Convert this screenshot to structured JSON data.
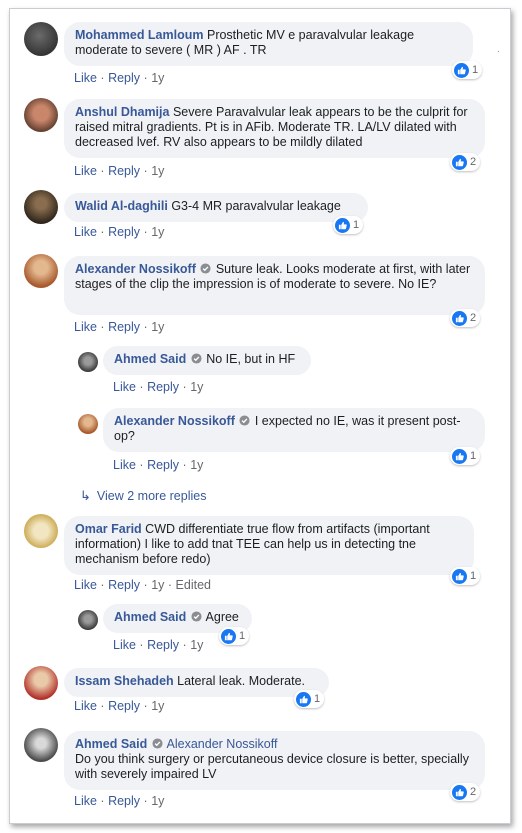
{
  "comments": [
    {
      "name": "Mohammed Lamloum",
      "text": "Prosthetic MV e paravalvular leakage moderate to severe ( MR ) AF . TR",
      "like": "Like",
      "reply": "Reply",
      "time": "1y",
      "reactions": "1"
    },
    {
      "name": "Anshul Dhamija",
      "text": "Severe Paravalvular leak appears to be the culprit for raised mitral gradients. Pt is in AFib. Moderate TR. LA/LV dilated with decreased lvef. RV also appears to be mildly dilated",
      "like": "Like",
      "reply": "Reply",
      "time": "1y",
      "reactions": "2"
    },
    {
      "name": "Walid Al-daghili",
      "text": "G3-4 MR paravalvular leakage",
      "like": "Like",
      "reply": "Reply",
      "time": "1y",
      "reactions": "1"
    },
    {
      "name": "Alexander Nossikoff",
      "text": "Suture leak. Looks moderate at first, with later stages of the clip the impression is of moderate to severe. No IE?",
      "like": "Like",
      "reply": "Reply",
      "time": "1y",
      "reactions": "2"
    },
    {
      "name": "Ahmed Said",
      "text": "No IE, but in HF",
      "like": "Like",
      "reply": "Reply",
      "time": "1y"
    },
    {
      "name": "Alexander Nossikoff",
      "text": "I expected no IE, was it present post-op?",
      "like": "Like",
      "reply": "Reply",
      "time": "1y",
      "reactions": "1"
    },
    {
      "name": "Omar Farid",
      "text": "CWD differentiate true flow from artifacts (important information) I like to add tnat TEE can help us in detecting tne mechanism before redo)",
      "like": "Like",
      "reply": "Reply",
      "time": "1y",
      "edited": "Edited",
      "reactions": "1"
    },
    {
      "name": "Ahmed Said",
      "text": "Agree",
      "like": "Like",
      "reply": "Reply",
      "time": "1y",
      "reactions": "1"
    },
    {
      "name": "Issam Shehadeh",
      "text": "Lateral leak. Moderate.",
      "like": "Like",
      "reply": "Reply",
      "time": "1y",
      "reactions": "1"
    },
    {
      "name": "Ahmed Said",
      "mention": "Alexander Nossikoff",
      "text": "Do you think surgery or percutaneous device closure is better, specially with severely impaired LV",
      "like": "Like",
      "reply": "Reply",
      "time": "1y",
      "reactions": "2"
    }
  ],
  "view_more_replies": "View 2 more replies",
  "separator": "·",
  "dot": ".",
  "colors": {
    "link": "#385898",
    "bubble": "#f0f2f5",
    "like_blue": "#1877f2",
    "meta": "#65676b"
  },
  "icons": [
    "like-thumb-icon",
    "verified-badge-icon",
    "reply-arrow-icon"
  ]
}
